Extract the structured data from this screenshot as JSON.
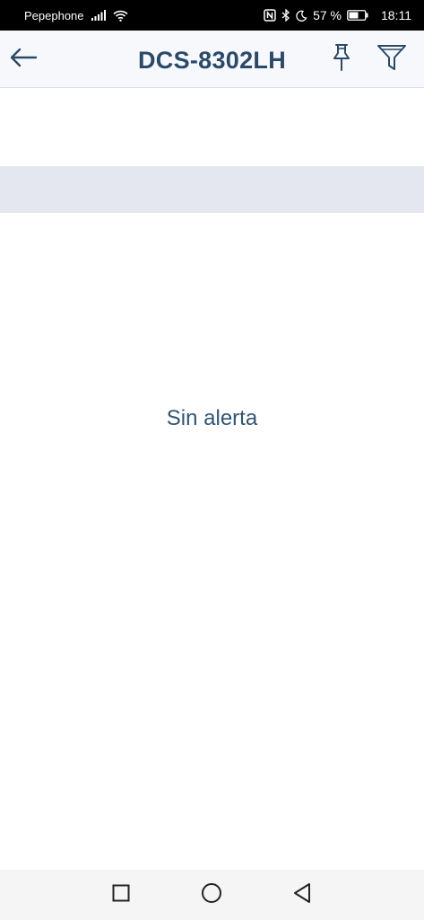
{
  "status_bar": {
    "carrier": "Pepephone",
    "battery_percent": "57 %",
    "time": "18:11",
    "icons": [
      "signal-icon",
      "wifi-icon",
      "nfc-icon",
      "bluetooth-icon",
      "moon-icon",
      "battery-icon"
    ]
  },
  "header": {
    "title": "DCS-8302LH",
    "back_icon": "arrow-left-icon",
    "pin_icon": "pushpin-icon",
    "filter_icon": "funnel-icon"
  },
  "main": {
    "empty_message": "Sin alerta"
  },
  "nav_bar": {
    "icons": [
      "square-icon",
      "circle-icon",
      "triangle-back-icon"
    ]
  },
  "colors": {
    "title": "#2a4a6b",
    "band": "#e4e7ef",
    "header_bg": "#f7f8fb",
    "message": "#2f5575"
  }
}
